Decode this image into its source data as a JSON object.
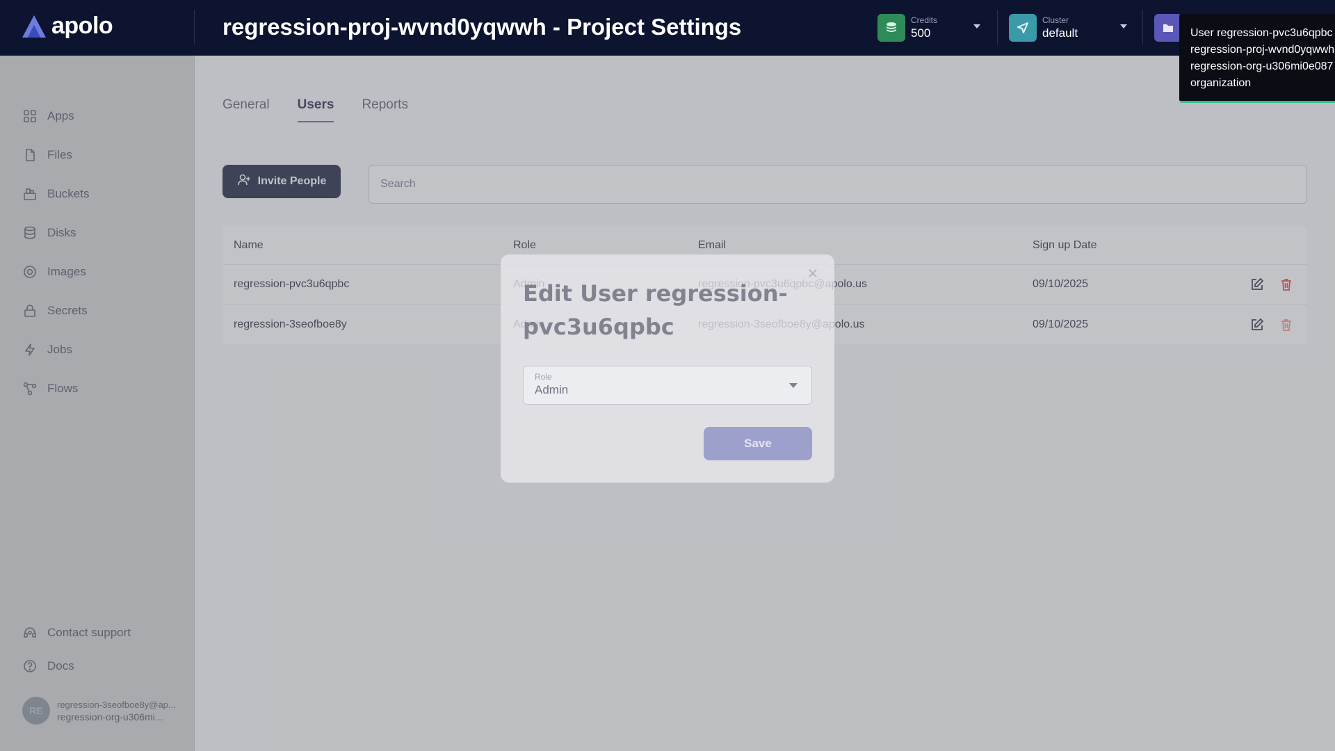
{
  "app": {
    "logo_text": "apolo"
  },
  "header": {
    "title": "regression-proj-wvnd0yqwwh - Project Settings",
    "credits": {
      "label": "Credits",
      "value": "500"
    },
    "cluster": {
      "label": "Cluster",
      "value": "default"
    }
  },
  "sidebar": {
    "items": [
      {
        "label": "Apps",
        "icon": "grid-icon"
      },
      {
        "label": "Files",
        "icon": "file-icon"
      },
      {
        "label": "Buckets",
        "icon": "bucket-icon"
      },
      {
        "label": "Disks",
        "icon": "database-icon"
      },
      {
        "label": "Images",
        "icon": "disc-icon"
      },
      {
        "label": "Secrets",
        "icon": "lock-icon"
      },
      {
        "label": "Jobs",
        "icon": "bolt-icon"
      },
      {
        "label": "Flows",
        "icon": "flow-icon"
      }
    ],
    "contact_support": "Contact support",
    "docs": "Docs",
    "user": {
      "initials": "RE",
      "email": "regression-3seofboe8y@ap...",
      "org": "regression-org-u306mi..."
    }
  },
  "tabs": [
    {
      "label": "General",
      "active": false
    },
    {
      "label": "Users",
      "active": true
    },
    {
      "label": "Reports",
      "active": false
    }
  ],
  "toolbar": {
    "invite_label": "Invite People",
    "search_placeholder": "Search"
  },
  "table": {
    "headers": {
      "name": "Name",
      "role": "Role",
      "email": "Email",
      "date": "Sign up Date"
    },
    "rows": [
      {
        "name": "regression-pvc3u6qpbc",
        "role": "Admin",
        "email": "regression-pvc3u6qpbc@apolo.us",
        "date": "09/10/2025"
      },
      {
        "name": "regression-3seofboe8y",
        "role": "Admin",
        "email": "regression-3seofboe8y@apolo.us",
        "date": "09/10/2025"
      }
    ]
  },
  "modal": {
    "title": "Edit User regression-pvc3u6qpbc",
    "role_label": "Role",
    "role_value": "Admin",
    "save_label": "Save"
  },
  "tooltip": {
    "lines": [
      "User regression-pvc3u6qpbc",
      "regression-proj-wvnd0yqwwh",
      "regression-org-u306mi0e087",
      "organization"
    ]
  },
  "colors": {
    "header_bg": "#0d1430",
    "accent": "#5b57b8",
    "credits_icon": "#2e8b57",
    "cluster_icon": "#3a9aa8",
    "project_icon": "#5b57b8",
    "danger": "#e53935"
  }
}
